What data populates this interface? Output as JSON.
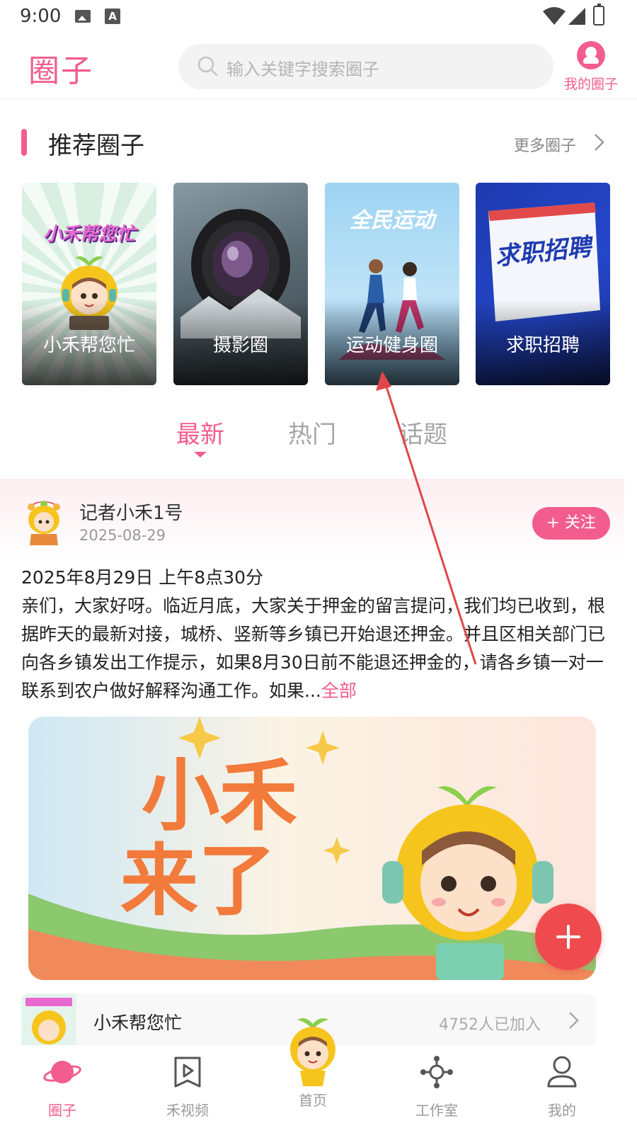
{
  "status_bar": {
    "time": "9:00",
    "a_icon": "A"
  },
  "header": {
    "title": "圈子",
    "search_placeholder": "输入关键字搜索圈子",
    "my_circle_label": "我的圈子"
  },
  "recommend": {
    "title": "推荐圈子",
    "more_label": "更多圈子",
    "cards": [
      {
        "label": "小禾帮您忙",
        "art_text": "小禾帮您忙"
      },
      {
        "label": "摄影圈"
      },
      {
        "label": "运动健身圈",
        "art_text": "全民运动"
      },
      {
        "label": "求职招聘",
        "art_text": "求职招聘"
      }
    ]
  },
  "tabs": [
    {
      "label": "最新",
      "active": true
    },
    {
      "label": "热门",
      "active": false
    },
    {
      "label": "话题",
      "active": false
    }
  ],
  "post": {
    "author": "记者小禾1号",
    "date": "2025-08-29",
    "follow_label": "+ 关注",
    "line1": "2025年8月29日 上午8点30分",
    "body": "亲们，大家好呀。临近月底，大家关于押金的留言提问，我们均已收到，根据昨天的最新对接，城桥、竖新等乡镇已开始退还押金。并且区相关部门已向各乡镇发出工作提示，如果8月30日前不能退还押金的，请各乡镇一对一联系到农户做好解释沟通工作。如果...",
    "more_label": "全部",
    "image_text_line1": "小禾",
    "image_text_line2": "来了",
    "circle_name": "小禾帮您忙",
    "circle_count": "4752人已加入"
  },
  "bottom_nav": [
    {
      "label": "圈子",
      "icon": "planet-icon",
      "active": true
    },
    {
      "label": "禾视频",
      "icon": "video-play-icon",
      "active": false
    },
    {
      "label": "首页",
      "icon": "mascot-icon",
      "active": false
    },
    {
      "label": "工作室",
      "icon": "studio-icon",
      "active": false
    },
    {
      "label": "我的",
      "icon": "user-icon",
      "active": false
    }
  ],
  "colors": {
    "accent": "#f25d8e",
    "fab": "#ef4b4f",
    "annotation_arrow": "#e0474a"
  }
}
